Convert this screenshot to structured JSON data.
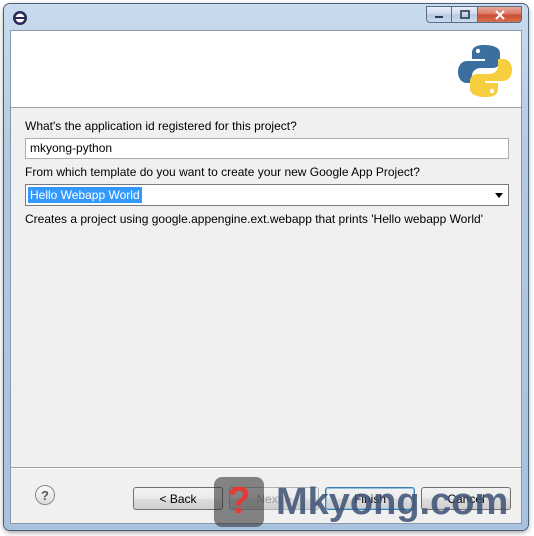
{
  "window": {
    "controls": [
      "minimize",
      "maximize",
      "close"
    ]
  },
  "form": {
    "app_id_label": "What's the application id registered for this project?",
    "app_id_value": "mkyong-python",
    "template_label": "From which template do you want to create your new Google App Project?",
    "template_selected": "Hello Webapp World",
    "template_description": "Creates a project using google.appengine.ext.webapp that prints 'Hello webapp World'"
  },
  "buttons": {
    "help": "?",
    "back": "< Back",
    "next": "Next >",
    "finish": "Finish",
    "cancel": "Cancel"
  },
  "watermark": {
    "text": "Mkyong.com",
    "icon_glyph": "?"
  },
  "colors": {
    "selection": "#3399ff",
    "python_blue": "#3a6f9f",
    "python_yellow": "#f7ce3e"
  }
}
